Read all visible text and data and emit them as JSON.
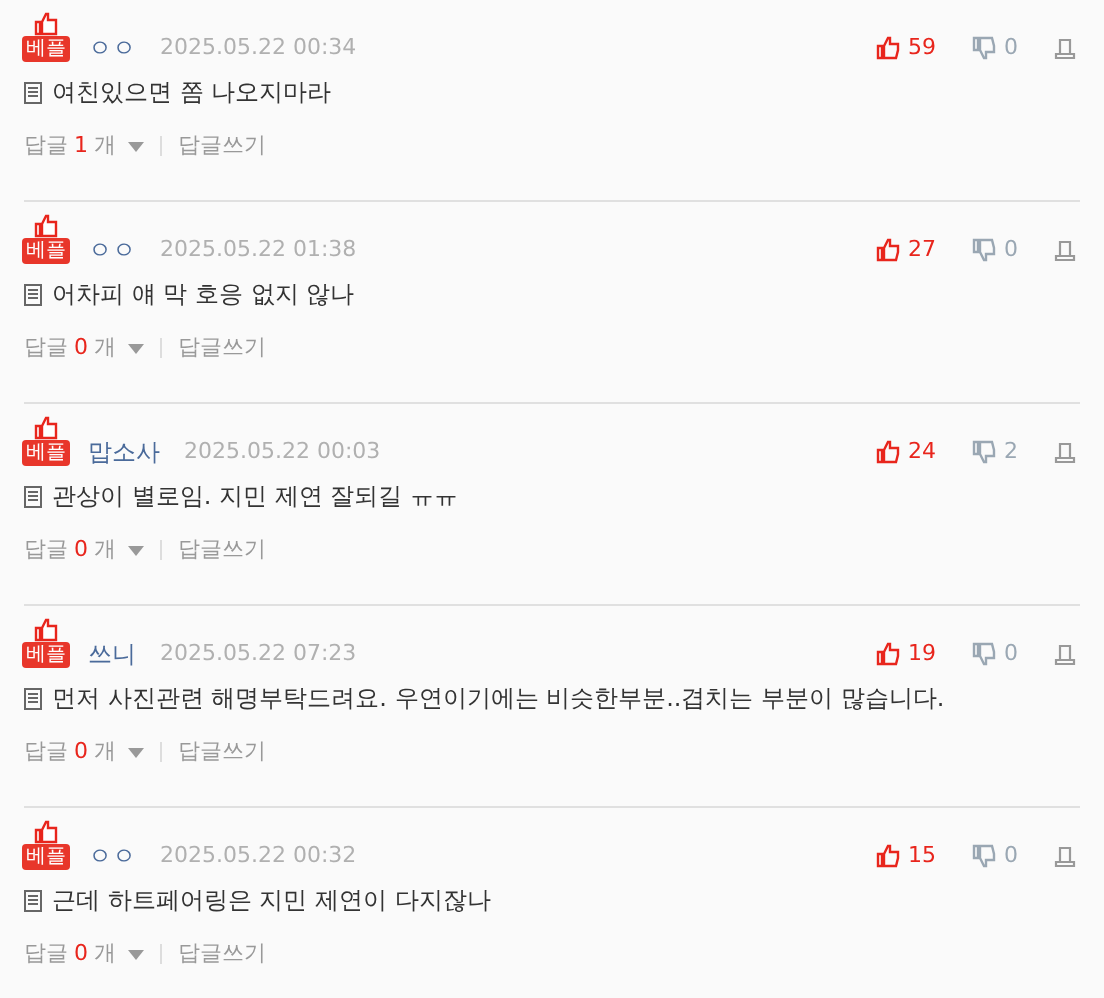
{
  "comments": [
    {
      "badge": "베플",
      "author": "ㅇㅇ",
      "date": "2025.05.22 00:34",
      "likes": "59",
      "dislikes": "0",
      "text": "여친있으면 쫌 나오지마라",
      "reply_label": "답글",
      "reply_count": "1",
      "reply_unit": "개",
      "write_reply": "답글쓰기"
    },
    {
      "badge": "베플",
      "author": "ㅇㅇ",
      "date": "2025.05.22 01:38",
      "likes": "27",
      "dislikes": "0",
      "text": "어차피 얘 막 호응 없지 않나",
      "reply_label": "답글",
      "reply_count": "0",
      "reply_unit": "개",
      "write_reply": "답글쓰기"
    },
    {
      "badge": "베플",
      "author": "맙소사",
      "date": "2025.05.22 00:03",
      "likes": "24",
      "dislikes": "2",
      "text": "관상이 별로임. 지민 제연 잘되길 ㅠㅠ",
      "reply_label": "답글",
      "reply_count": "0",
      "reply_unit": "개",
      "write_reply": "답글쓰기"
    },
    {
      "badge": "베플",
      "author": "쓰니",
      "date": "2025.05.22 07:23",
      "likes": "19",
      "dislikes": "0",
      "text": "먼저 사진관련 해명부탁드려요. 우연이기에는 비슷한부분..겹치는 부분이 많습니다.",
      "reply_label": "답글",
      "reply_count": "0",
      "reply_unit": "개",
      "write_reply": "답글쓰기"
    },
    {
      "badge": "베플",
      "author": "ㅇㅇ",
      "date": "2025.05.22 00:32",
      "likes": "15",
      "dislikes": "0",
      "text": "근데 하트페어링은 지민 제연이 다지잖나",
      "reply_label": "답글",
      "reply_count": "0",
      "reply_unit": "개",
      "write_reply": "답글쓰기"
    }
  ]
}
